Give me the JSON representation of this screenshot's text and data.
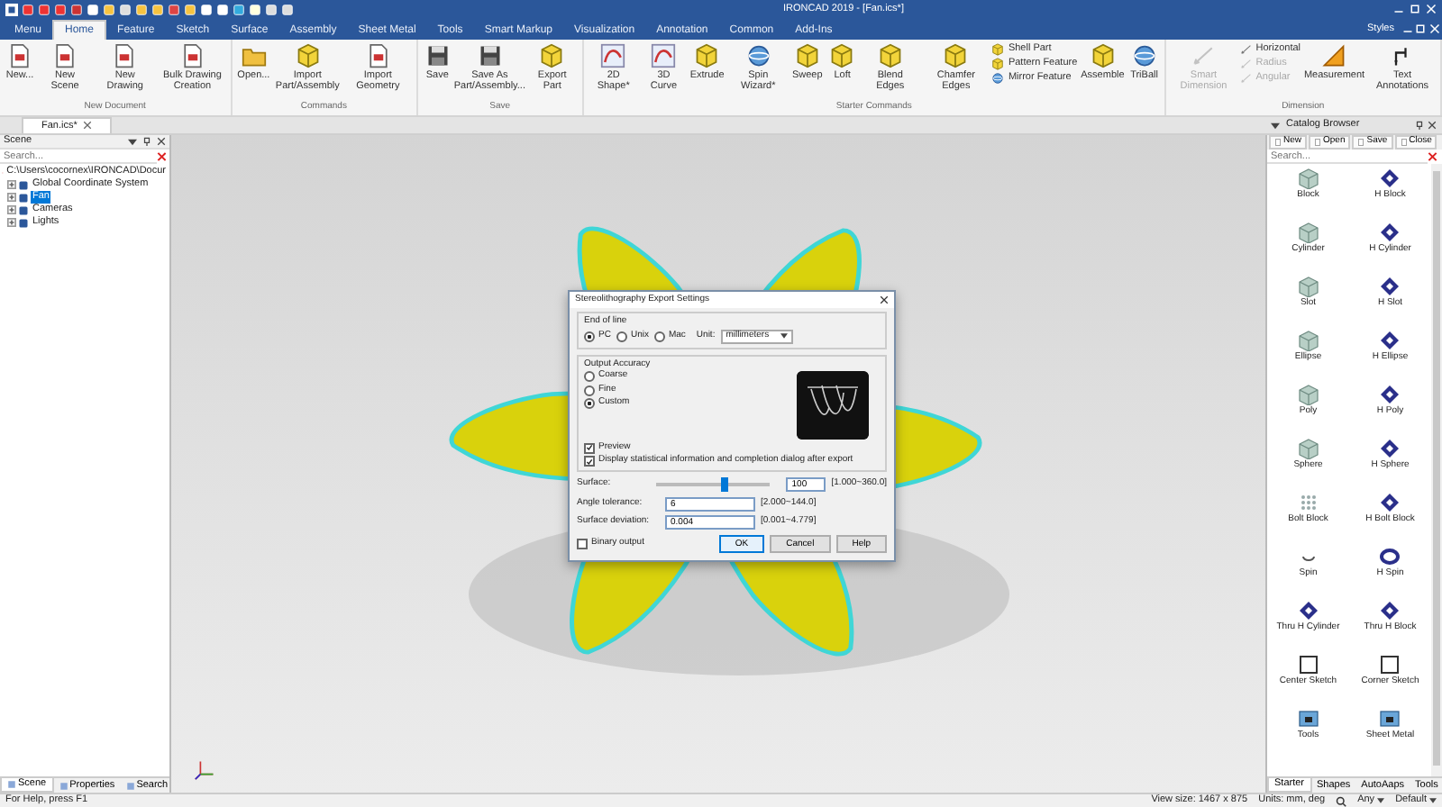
{
  "window": {
    "title": "IRONCAD 2019 - [Fan.ics*]"
  },
  "ribbon_tabs": [
    {
      "label": "Menu",
      "selected": false
    },
    {
      "label": "Home",
      "selected": true
    },
    {
      "label": "Feature",
      "selected": false
    },
    {
      "label": "Sketch",
      "selected": false
    },
    {
      "label": "Surface",
      "selected": false
    },
    {
      "label": "Assembly",
      "selected": false
    },
    {
      "label": "Sheet Metal",
      "selected": false
    },
    {
      "label": "Tools",
      "selected": false
    },
    {
      "label": "Smart Markup",
      "selected": false
    },
    {
      "label": "Visualization",
      "selected": false
    },
    {
      "label": "Annotation",
      "selected": false
    },
    {
      "label": "Common",
      "selected": false
    },
    {
      "label": "Add-Ins",
      "selected": false
    }
  ],
  "styles_menu": "Styles",
  "ribbon_groups": [
    {
      "label": "New Document",
      "items": [
        {
          "kind": "large",
          "label": "New..."
        },
        {
          "kind": "large",
          "label": "New Scene"
        },
        {
          "kind": "large",
          "label": "New Drawing"
        },
        {
          "kind": "large",
          "label": "Bulk Drawing Creation"
        }
      ]
    },
    {
      "label": "Commands",
      "items": [
        {
          "kind": "large",
          "label": "Open..."
        },
        {
          "kind": "large",
          "label": "Import Part/Assembly"
        },
        {
          "kind": "large",
          "label": "Import Geometry"
        }
      ]
    },
    {
      "label": "Save",
      "items": [
        {
          "kind": "large",
          "label": "Save"
        },
        {
          "kind": "large",
          "label": "Save As Part/Assembly..."
        },
        {
          "kind": "large",
          "label": "Export Part"
        }
      ]
    },
    {
      "label": "Starter Commands",
      "items": [
        {
          "kind": "large",
          "label": "2D Shape*"
        },
        {
          "kind": "large",
          "label": "3D Curve"
        },
        {
          "kind": "large",
          "label": "Extrude"
        },
        {
          "kind": "large",
          "label": "Spin Wizard*"
        },
        {
          "kind": "large",
          "label": "Sweep"
        },
        {
          "kind": "large",
          "label": "Loft"
        },
        {
          "kind": "large",
          "label": "Blend Edges"
        },
        {
          "kind": "large",
          "label": "Chamfer Edges"
        },
        {
          "kind": "stack",
          "items": [
            {
              "label": "Shell Part"
            },
            {
              "label": "Pattern Feature"
            },
            {
              "label": "Mirror Feature"
            }
          ]
        },
        {
          "kind": "large",
          "label": "Assemble"
        },
        {
          "kind": "large",
          "label": "TriBall"
        }
      ]
    },
    {
      "label": "Dimension",
      "items": [
        {
          "kind": "large",
          "label": "Smart Dimension",
          "disabled": true
        },
        {
          "kind": "stack",
          "items": [
            {
              "label": "Horizontal",
              "disabled": false
            },
            {
              "label": "Radius",
              "disabled": true
            },
            {
              "label": "Angular",
              "disabled": true
            }
          ]
        },
        {
          "kind": "large",
          "label": "Measurement",
          "disabled": false
        },
        {
          "kind": "large",
          "label": "Text Annotations",
          "disabled": false
        }
      ]
    }
  ],
  "document_tab": "Fan.ics*",
  "scene_panel": {
    "title": "Scene",
    "search": {
      "placeholder": "Search..."
    },
    "tree": [
      {
        "label": "C:\\Users\\cocornex\\IRONCAD\\Docur",
        "selected": false,
        "children": [
          {
            "label": "Global Coordinate System",
            "selected": false
          },
          {
            "label": "Fan",
            "selected": true
          },
          {
            "label": "Cameras",
            "selected": false
          },
          {
            "label": "Lights",
            "selected": false
          }
        ]
      }
    ],
    "tabs": [
      {
        "label": "Scene",
        "selected": true
      },
      {
        "label": "Properties",
        "selected": false
      },
      {
        "label": "Search",
        "selected": false
      }
    ]
  },
  "dialog": {
    "title": "Stereolithography Export Settings",
    "end_of_line": {
      "label": "End of line",
      "options": [
        {
          "label": "PC",
          "selected": true
        },
        {
          "label": "Unix",
          "selected": false
        },
        {
          "label": "Mac",
          "selected": false
        }
      ],
      "unit_label": "Unit:",
      "unit": "millimeters"
    },
    "output_accuracy": {
      "label": "Output Accuracy",
      "options": [
        {
          "label": "Coarse",
          "selected": false
        },
        {
          "label": "Fine",
          "selected": false
        },
        {
          "label": "Custom",
          "selected": true
        }
      ]
    },
    "checks": [
      {
        "label": "Preview",
        "checked": true
      },
      {
        "label": "Display statistical information and completion dialog after export",
        "checked": true
      }
    ],
    "surface": {
      "label": "Surface:",
      "level": 0.6,
      "value": "100",
      "range": "[1.000~360.0]"
    },
    "fields": [
      {
        "label": "Angle tolerance:",
        "value": "6",
        "range": "[2.000~144.0]"
      },
      {
        "label": "Surface deviation:",
        "value": "0.004",
        "range": "[0.001~4.779]"
      }
    ],
    "binary_output": {
      "label": "Binary output",
      "checked": false
    },
    "buttons": [
      "OK",
      "Cancel",
      "Help"
    ]
  },
  "catalog": {
    "title": "Catalog Browser",
    "buttons": [
      "New",
      "Open",
      "Save",
      "Close"
    ],
    "search": {
      "placeholder": "Search..."
    },
    "items": [
      {
        "label": "Block",
        "kind": "solid"
      },
      {
        "label": "H Block",
        "kind": "hollow"
      },
      {
        "label": "Cylinder",
        "kind": "solid"
      },
      {
        "label": "H Cylinder",
        "kind": "hollow"
      },
      {
        "label": "Slot",
        "kind": "solid"
      },
      {
        "label": "H Slot",
        "kind": "hollow"
      },
      {
        "label": "Ellipse",
        "kind": "solid"
      },
      {
        "label": "H Ellipse",
        "kind": "hollow"
      },
      {
        "label": "Poly",
        "kind": "solid"
      },
      {
        "label": "H Poly",
        "kind": "hollow"
      },
      {
        "label": "Sphere",
        "kind": "solid"
      },
      {
        "label": "H Sphere",
        "kind": "hollow"
      },
      {
        "label": "Bolt Block",
        "kind": "bolt"
      },
      {
        "label": "H Bolt Block",
        "kind": "hollow"
      },
      {
        "label": "Spin",
        "kind": "spin"
      },
      {
        "label": "H Spin",
        "kind": "ring"
      },
      {
        "label": "Thru H Cylinder",
        "kind": "hollow"
      },
      {
        "label": "Thru H Block",
        "kind": "hollow"
      },
      {
        "label": "Center Sketch",
        "kind": "sketch"
      },
      {
        "label": "Corner Sketch",
        "kind": "sketch"
      },
      {
        "label": "Tools",
        "kind": "folder"
      },
      {
        "label": "Sheet Metal",
        "kind": "folder"
      }
    ],
    "tabs": [
      {
        "label": "Starter",
        "selected": true
      },
      {
        "label": "Shapes",
        "selected": false
      },
      {
        "label": "AutoAaps",
        "selected": false
      },
      {
        "label": "Tools",
        "selected": false
      }
    ]
  },
  "status_bar": {
    "help": "For Help, press F1",
    "view_size": "View size: 1467 x 875",
    "units": "Units: mm, deg",
    "filter": "Any",
    "style": "Default"
  }
}
